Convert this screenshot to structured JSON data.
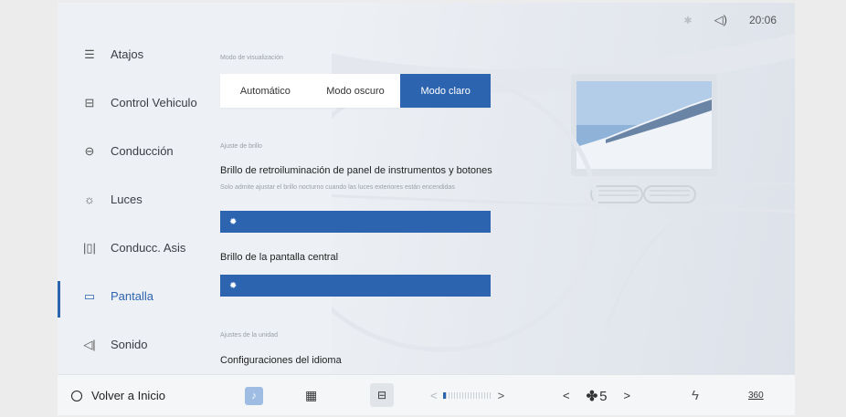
{
  "status": {
    "bluetooth_icon": "bluetooth-icon",
    "volume_icon": "volume-icon",
    "time": "20:06"
  },
  "sidebar": {
    "items": [
      {
        "label": "Atajos",
        "icon": "sliders-icon",
        "active": false
      },
      {
        "label": "Control Vehiculo",
        "icon": "car-icon",
        "active": false
      },
      {
        "label": "Conducción",
        "icon": "steering-wheel-icon",
        "active": false
      },
      {
        "label": "Luces",
        "icon": "light-icon",
        "active": false
      },
      {
        "label": "Conducc. Asis",
        "icon": "assist-icon",
        "active": false
      },
      {
        "label": "Pantalla",
        "icon": "display-icon",
        "active": true
      },
      {
        "label": "Sonido",
        "icon": "speaker-icon",
        "active": false
      }
    ]
  },
  "display_mode": {
    "section": "Modo de visualización",
    "options": [
      "Automático",
      "Modo oscuro",
      "Modo claro"
    ],
    "selected": "Modo claro"
  },
  "brightness": {
    "section": "Ajuste de brillo",
    "panel_label": "Brillo de retroiluminación de panel de instrumentos y botones",
    "panel_note": "Solo admite ajustar el brillo nocturno cuando las luces exteriores están encendidas",
    "panel_value": 1,
    "center_label": "Brillo de la pantalla central",
    "center_value": 1
  },
  "units": {
    "section": "Ajustes de la unidad",
    "language_label": "Configuraciones del idioma"
  },
  "bottom": {
    "home_label": "Volver a Inicio",
    "music_icon": "music-icon",
    "apps_icon": "apps-grid-icon",
    "car_icon": "car-settings-icon",
    "temp_prev": "<",
    "temp_next": ">",
    "fan_prev": "<",
    "fan_value": "5",
    "fan_next": ">",
    "power_icon": "lightning-icon",
    "view_label": "360"
  },
  "colors": {
    "accent": "#2d64b0",
    "background": "#edf0f4"
  }
}
